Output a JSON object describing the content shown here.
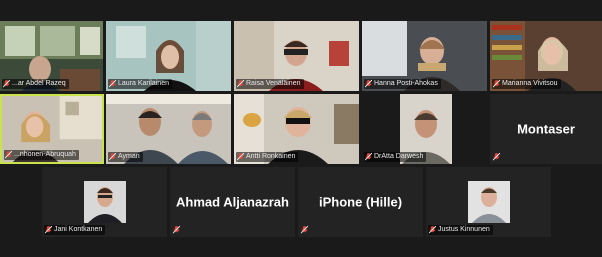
{
  "app": "Video conference gallery view",
  "participants": [
    {
      "id": "p1",
      "name": "...ar Abdel Razeq",
      "video": true,
      "muted": true
    },
    {
      "id": "p2",
      "name": "Laura Karilainen",
      "video": true,
      "muted": true
    },
    {
      "id": "p3",
      "name": "Raisa Venäläinen",
      "video": true,
      "muted": true
    },
    {
      "id": "p4",
      "name": "Hanna Posti-Ahokas",
      "video": true,
      "muted": true
    },
    {
      "id": "p5",
      "name": "Marianna Vivitsou",
      "video": true,
      "muted": true
    },
    {
      "id": "p6",
      "name": "...nhonen-Abruquah",
      "video": true,
      "muted": true,
      "speaking": true
    },
    {
      "id": "p7",
      "name": "Ayman",
      "video": true,
      "muted": true
    },
    {
      "id": "p8",
      "name": "Antti Ronkainen",
      "video": true,
      "muted": true
    },
    {
      "id": "p9",
      "name": "DrAtta Darwesh",
      "video": true,
      "muted": true
    },
    {
      "id": "p10",
      "name": "",
      "display": "Montaser",
      "video": false,
      "muted": true
    },
    {
      "id": "p11",
      "name": "Jani Kontkanen",
      "video": false,
      "photo": true,
      "muted": true
    },
    {
      "id": "p12",
      "name": "",
      "display": "Ahmad Aljanazrah",
      "video": false,
      "muted": true
    },
    {
      "id": "p13",
      "name": "",
      "display": "iPhone (Hille)",
      "video": false,
      "muted": true
    },
    {
      "id": "p14",
      "name": "Justus Kinnunen",
      "video": false,
      "photo": true,
      "muted": true
    }
  ],
  "colors": {
    "background": "#1a1a1a",
    "tile": "#232323",
    "speaking_border": "#c9e34a",
    "mic_muted": "#e0453a"
  }
}
